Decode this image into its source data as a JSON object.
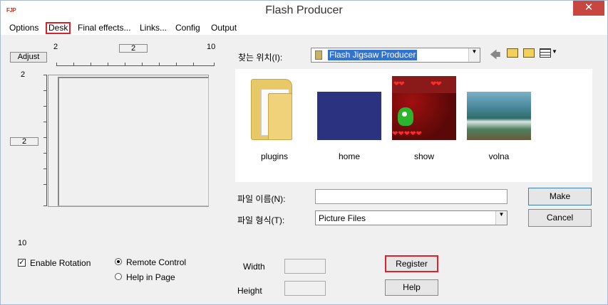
{
  "window": {
    "title": "Flash Producer",
    "app_icon": "FJP",
    "close_glyph": "✕"
  },
  "menu": [
    "Options",
    "Desk",
    "Final effects...",
    "Links...",
    "Config",
    "Output"
  ],
  "desk": {
    "adjust_label": "Adjust",
    "ruler_start": "2",
    "ruler_value": "2",
    "ruler_end": "10",
    "vruler_start": "2",
    "vruler_value": "2",
    "vruler_end": "10",
    "enable_rotation_label": "Enable Rotation",
    "enable_rotation_checked": true,
    "remote_control_label": "Remote Control",
    "help_in_page_label": "Help in Page",
    "width_label": "Width",
    "height_label": "Height",
    "register_label": "Register",
    "help_label": "Help"
  },
  "file_dialog": {
    "look_in_label": "찾는 위치(I):",
    "look_in_value": "Flash Jigsaw Producer",
    "files": [
      {
        "name": "plugins",
        "type": "folder"
      },
      {
        "name": "home",
        "type": "image"
      },
      {
        "name": "show",
        "type": "image"
      },
      {
        "name": "volna",
        "type": "image"
      }
    ],
    "filename_label": "파일 이름(N):",
    "filename_value": "",
    "filetype_label": "파일 형식(T):",
    "filetype_value": "Picture Files",
    "make_label": "Make",
    "cancel_label": "Cancel"
  }
}
